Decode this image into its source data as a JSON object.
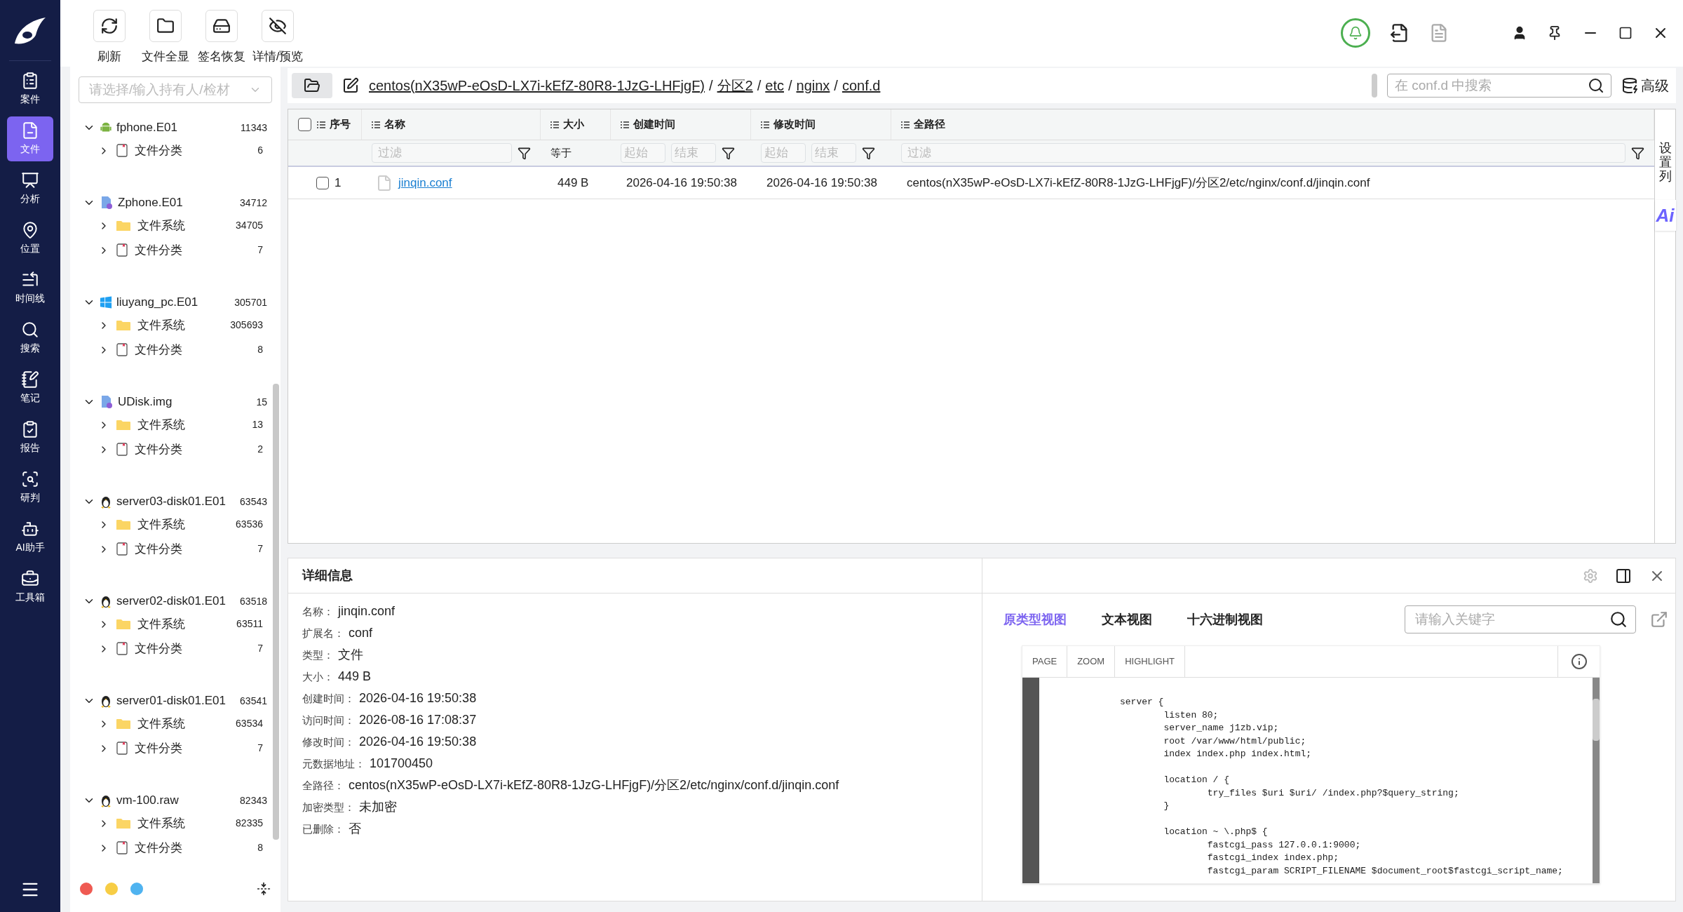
{
  "nav": [
    {
      "label": "案件",
      "kind": "case",
      "selected": false
    },
    {
      "label": "文件",
      "kind": "file",
      "selected": true
    },
    {
      "label": "分析",
      "kind": "analysis",
      "selected": false
    },
    {
      "label": "位置",
      "kind": "location",
      "selected": false
    },
    {
      "label": "时间线",
      "kind": "timeline",
      "selected": false
    },
    {
      "label": "搜索",
      "kind": "search",
      "selected": false
    },
    {
      "label": "笔记",
      "kind": "note",
      "selected": false
    },
    {
      "label": "报告",
      "kind": "report",
      "selected": false
    },
    {
      "label": "研判",
      "kind": "judge",
      "selected": false
    },
    {
      "label": "AI助手",
      "kind": "ai",
      "selected": false
    },
    {
      "label": "工具箱",
      "kind": "toolbox",
      "selected": false
    }
  ],
  "toolbar": [
    {
      "label": "刷新",
      "kind": "refresh"
    },
    {
      "label": "文件全显",
      "kind": "folder"
    },
    {
      "label": "签名恢复",
      "kind": "disk"
    },
    {
      "label": "详情/预览",
      "kind": "eye-off"
    }
  ],
  "holder_select": {
    "placeholder": "请选择/输入持有人/检材"
  },
  "tree": [
    {
      "name": "fphone.E01",
      "count": "11343",
      "kind": "android",
      "expanded": true,
      "children": [
        {
          "name": "文件分类",
          "count": "6",
          "kind": "category",
          "expanded": false
        }
      ]
    },
    {
      "name": "Zphone.E01",
      "count": "34712",
      "kind": "image",
      "expanded": true,
      "children": [
        {
          "name": "文件系统",
          "count": "34705",
          "kind": "folder",
          "expanded": false
        },
        {
          "name": "文件分类",
          "count": "7",
          "kind": "category",
          "expanded": false
        }
      ]
    },
    {
      "name": "liuyang_pc.E01",
      "count": "305701",
      "kind": "windows",
      "expanded": true,
      "children": [
        {
          "name": "文件系统",
          "count": "305693",
          "kind": "folder",
          "expanded": false
        },
        {
          "name": "文件分类",
          "count": "8",
          "kind": "category",
          "expanded": false
        }
      ]
    },
    {
      "name": "UDisk.img",
      "count": "15",
      "kind": "image",
      "expanded": true,
      "children": [
        {
          "name": "文件系统",
          "count": "13",
          "kind": "folder",
          "expanded": false
        },
        {
          "name": "文件分类",
          "count": "2",
          "kind": "category",
          "expanded": false
        }
      ]
    },
    {
      "name": "server03-disk01.E01",
      "count": "63543",
      "kind": "linux",
      "expanded": true,
      "children": [
        {
          "name": "文件系统",
          "count": "63536",
          "kind": "folder",
          "expanded": false
        },
        {
          "name": "文件分类",
          "count": "7",
          "kind": "category",
          "expanded": false
        }
      ]
    },
    {
      "name": "server02-disk01.E01",
      "count": "63518",
      "kind": "linux",
      "expanded": true,
      "children": [
        {
          "name": "文件系统",
          "count": "63511",
          "kind": "folder",
          "expanded": false
        },
        {
          "name": "文件分类",
          "count": "7",
          "kind": "category",
          "expanded": false
        }
      ]
    },
    {
      "name": "server01-disk01.E01",
      "count": "63541",
      "kind": "linux",
      "expanded": true,
      "children": [
        {
          "name": "文件系统",
          "count": "63534",
          "kind": "folder",
          "expanded": false
        },
        {
          "name": "文件分类",
          "count": "7",
          "kind": "category",
          "expanded": false
        }
      ]
    },
    {
      "name": "vm-100.raw",
      "count": "82343",
      "kind": "linux",
      "expanded": true,
      "children": [
        {
          "name": "文件系统",
          "count": "82335",
          "kind": "folder",
          "expanded": false
        },
        {
          "name": "文件分类",
          "count": "8",
          "kind": "category",
          "expanded": false
        }
      ]
    }
  ],
  "color_dots": [
    {
      "color": "#ef5a52"
    },
    {
      "color": "#f7cd45"
    },
    {
      "color": "#4fb3f0"
    }
  ],
  "breadcrumb_separator": "/",
  "breadcrumb": [
    "centos(nX35wP-eOsD-LX7i-kEfZ-80R8-1JzG-LHFjgF)",
    "分区2",
    "etc",
    "nginx",
    "conf.d"
  ],
  "folder_search": {
    "placeholder": "在 conf.d 中搜索"
  },
  "advanced_button": "高级",
  "table": {
    "columns": [
      {
        "label": "序号",
        "filter": {
          "kind": "none"
        }
      },
      {
        "label": "名称",
        "filter": {
          "kind": "text",
          "placeholder": "过滤"
        }
      },
      {
        "label": "大小",
        "filter": {
          "kind": "label",
          "text": "等于"
        }
      },
      {
        "label": "创建时间",
        "filter": {
          "kind": "range",
          "start": {
            "placeholder": "起始"
          },
          "end": {
            "placeholder": "结束"
          }
        }
      },
      {
        "label": "修改时间",
        "filter": {
          "kind": "range",
          "start": {
            "placeholder": "起始"
          },
          "end": {
            "placeholder": "结束"
          }
        }
      },
      {
        "label": "全路径",
        "filter": {
          "kind": "text",
          "placeholder": "过滤"
        }
      }
    ],
    "all_checked": false,
    "rows": [
      {
        "checked": false,
        "index": "1",
        "name": "jinqin.conf",
        "size": "449 B",
        "created": "2026-04-16 19:50:38",
        "modified": "2026-04-16 19:50:38",
        "path": "centos(nX35wP-eOsD-LX7i-kEfZ-80R8-1JzG-LHFjgF)/分区2/etc/nginx/conf.d/jinqin.conf"
      }
    ],
    "column_settings": "设置列"
  },
  "ai_button": "Ai",
  "details": {
    "title": "详细信息",
    "fields": [
      {
        "label": "名称：",
        "value": "jinqin.conf"
      },
      {
        "label": "扩展名：",
        "value": "conf"
      },
      {
        "label": "类型：",
        "value": "文件"
      },
      {
        "label": "大小：",
        "value": "449 B"
      },
      {
        "label": "创建时间：",
        "value": "2026-04-16 19:50:38"
      },
      {
        "label": "访问时间：",
        "value": "2026-08-16 17:08:37"
      },
      {
        "label": "修改时间：",
        "value": "2026-04-16 19:50:38"
      },
      {
        "label": "元数据地址：",
        "value": "101700450"
      },
      {
        "label": "全路径：",
        "value": "centos(nX35wP-eOsD-LX7i-kEfZ-80R8-1JzG-LHFjgF)/分区2/etc/nginx/conf.d/jinqin.conf"
      },
      {
        "label": "加密类型：",
        "value": "未加密"
      },
      {
        "label": "已删除：",
        "value": "否"
      }
    ]
  },
  "viewer": {
    "tabs": [
      {
        "label": "原类型视图",
        "selected": true
      },
      {
        "label": "文本视图",
        "selected": false
      },
      {
        "label": "十六进制视图",
        "selected": false
      }
    ],
    "search": {
      "placeholder": "请输入关键字"
    },
    "tools": [
      "PAGE",
      "ZOOM",
      "HIGHLIGHT"
    ],
    "code": "server {\n        listen 80;\n        server_name j1zb.vip;\n        root /var/www/html/public;\n        index index.php index.html;\n\n        location / {\n                try_files $uri $uri/ /index.php?$query_string;\n        }\n\n        location ~ \\.php$ {\n                fastcgi_pass 127.0.0.1:9000;\n                fastcgi_index index.php;\n                fastcgi_param SCRIPT_FILENAME $document_root$fastcgi_script_name;"
  }
}
